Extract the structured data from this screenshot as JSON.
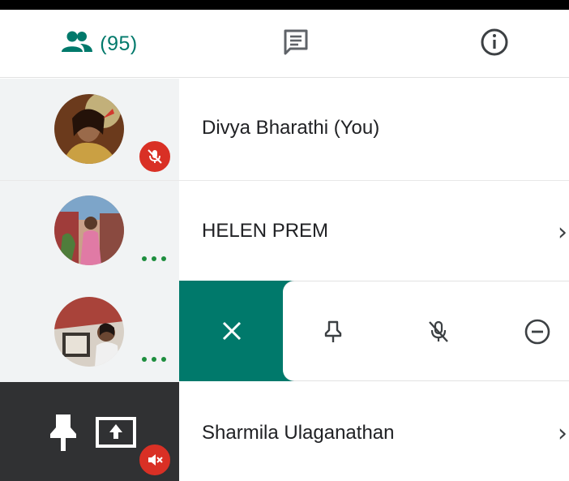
{
  "tabs": {
    "people_count": "(95)",
    "items": [
      {
        "name": "people",
        "icon": "people-icon"
      },
      {
        "name": "chat",
        "icon": "chat-icon"
      },
      {
        "name": "info",
        "icon": "info-icon"
      }
    ],
    "accent_color": "#00796b"
  },
  "participants": [
    {
      "name": "Divya Bharathi (You)",
      "muted": true
    },
    {
      "name": "HELEN PREM",
      "muted": false
    },
    {
      "name": "",
      "muted": false,
      "actions_open": true
    },
    {
      "name": "Sharmila Ulaganathan",
      "muted": true,
      "pinned": true,
      "presenting": true
    }
  ],
  "actions": {
    "icons": [
      "close-icon",
      "pin-icon",
      "mute-icon",
      "remove-icon"
    ]
  },
  "colors": {
    "mute_badge": "#d93025",
    "more_dots": "#1e8e3e",
    "action_bar": "#00796b"
  }
}
